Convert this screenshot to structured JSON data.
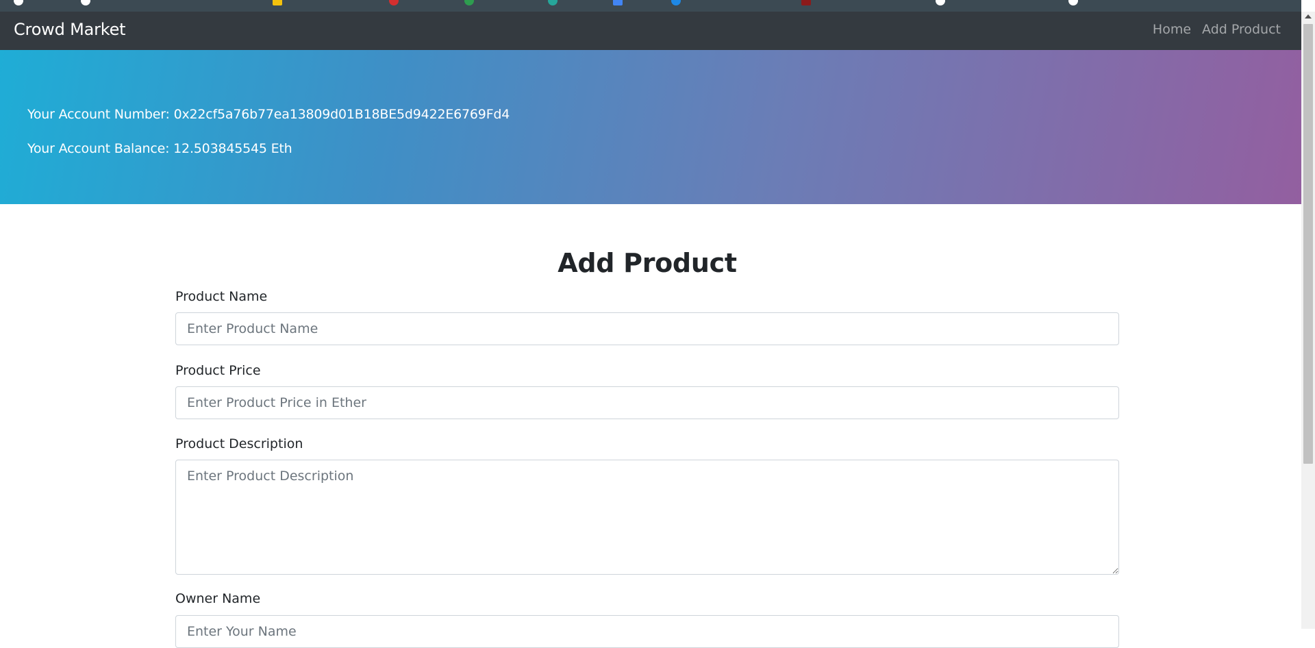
{
  "navbar": {
    "brand": "Crowd Market",
    "links": [
      "Home",
      "Add Product"
    ]
  },
  "account": {
    "number_line": "Your Account Number: 0x22cf5a76b77ea13809d01B18BE5d9422E6769Fd4",
    "balance_line": "Your Account Balance: 12.503845545 Eth"
  },
  "form": {
    "title": "Add Product",
    "product_name": {
      "label": "Product Name",
      "placeholder": "Enter Product Name"
    },
    "product_price": {
      "label": "Product Price",
      "placeholder": "Enter Product Price in Ether"
    },
    "product_description": {
      "label": "Product Description",
      "placeholder": "Enter Product Description"
    },
    "owner_name": {
      "label": "Owner Name",
      "placeholder": "Enter Your Name"
    }
  },
  "colors": {
    "navbar_bg": "#343a40",
    "hero_gradient_start": "#1fadd6",
    "hero_gradient_end": "#935fa0"
  }
}
